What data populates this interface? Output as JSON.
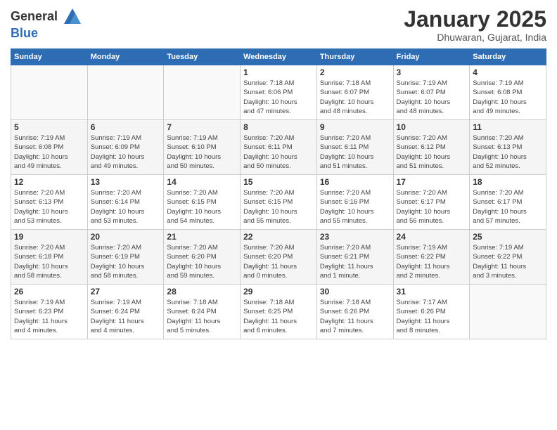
{
  "logo": {
    "general": "General",
    "blue": "Blue"
  },
  "header": {
    "title": "January 2025",
    "subtitle": "Dhuwaran, Gujarat, India"
  },
  "days_of_week": [
    "Sunday",
    "Monday",
    "Tuesday",
    "Wednesday",
    "Thursday",
    "Friday",
    "Saturday"
  ],
  "weeks": [
    [
      {
        "day": "",
        "info": ""
      },
      {
        "day": "",
        "info": ""
      },
      {
        "day": "",
        "info": ""
      },
      {
        "day": "1",
        "info": "Sunrise: 7:18 AM\nSunset: 6:06 PM\nDaylight: 10 hours\nand 47 minutes."
      },
      {
        "day": "2",
        "info": "Sunrise: 7:18 AM\nSunset: 6:07 PM\nDaylight: 10 hours\nand 48 minutes."
      },
      {
        "day": "3",
        "info": "Sunrise: 7:19 AM\nSunset: 6:07 PM\nDaylight: 10 hours\nand 48 minutes."
      },
      {
        "day": "4",
        "info": "Sunrise: 7:19 AM\nSunset: 6:08 PM\nDaylight: 10 hours\nand 49 minutes."
      }
    ],
    [
      {
        "day": "5",
        "info": "Sunrise: 7:19 AM\nSunset: 6:08 PM\nDaylight: 10 hours\nand 49 minutes."
      },
      {
        "day": "6",
        "info": "Sunrise: 7:19 AM\nSunset: 6:09 PM\nDaylight: 10 hours\nand 49 minutes."
      },
      {
        "day": "7",
        "info": "Sunrise: 7:19 AM\nSunset: 6:10 PM\nDaylight: 10 hours\nand 50 minutes."
      },
      {
        "day": "8",
        "info": "Sunrise: 7:20 AM\nSunset: 6:11 PM\nDaylight: 10 hours\nand 50 minutes."
      },
      {
        "day": "9",
        "info": "Sunrise: 7:20 AM\nSunset: 6:11 PM\nDaylight: 10 hours\nand 51 minutes."
      },
      {
        "day": "10",
        "info": "Sunrise: 7:20 AM\nSunset: 6:12 PM\nDaylight: 10 hours\nand 51 minutes."
      },
      {
        "day": "11",
        "info": "Sunrise: 7:20 AM\nSunset: 6:13 PM\nDaylight: 10 hours\nand 52 minutes."
      }
    ],
    [
      {
        "day": "12",
        "info": "Sunrise: 7:20 AM\nSunset: 6:13 PM\nDaylight: 10 hours\nand 53 minutes."
      },
      {
        "day": "13",
        "info": "Sunrise: 7:20 AM\nSunset: 6:14 PM\nDaylight: 10 hours\nand 53 minutes."
      },
      {
        "day": "14",
        "info": "Sunrise: 7:20 AM\nSunset: 6:15 PM\nDaylight: 10 hours\nand 54 minutes."
      },
      {
        "day": "15",
        "info": "Sunrise: 7:20 AM\nSunset: 6:15 PM\nDaylight: 10 hours\nand 55 minutes."
      },
      {
        "day": "16",
        "info": "Sunrise: 7:20 AM\nSunset: 6:16 PM\nDaylight: 10 hours\nand 55 minutes."
      },
      {
        "day": "17",
        "info": "Sunrise: 7:20 AM\nSunset: 6:17 PM\nDaylight: 10 hours\nand 56 minutes."
      },
      {
        "day": "18",
        "info": "Sunrise: 7:20 AM\nSunset: 6:17 PM\nDaylight: 10 hours\nand 57 minutes."
      }
    ],
    [
      {
        "day": "19",
        "info": "Sunrise: 7:20 AM\nSunset: 6:18 PM\nDaylight: 10 hours\nand 58 minutes."
      },
      {
        "day": "20",
        "info": "Sunrise: 7:20 AM\nSunset: 6:19 PM\nDaylight: 10 hours\nand 58 minutes."
      },
      {
        "day": "21",
        "info": "Sunrise: 7:20 AM\nSunset: 6:20 PM\nDaylight: 10 hours\nand 59 minutes."
      },
      {
        "day": "22",
        "info": "Sunrise: 7:20 AM\nSunset: 6:20 PM\nDaylight: 11 hours\nand 0 minutes."
      },
      {
        "day": "23",
        "info": "Sunrise: 7:20 AM\nSunset: 6:21 PM\nDaylight: 11 hours\nand 1 minute."
      },
      {
        "day": "24",
        "info": "Sunrise: 7:19 AM\nSunset: 6:22 PM\nDaylight: 11 hours\nand 2 minutes."
      },
      {
        "day": "25",
        "info": "Sunrise: 7:19 AM\nSunset: 6:22 PM\nDaylight: 11 hours\nand 3 minutes."
      }
    ],
    [
      {
        "day": "26",
        "info": "Sunrise: 7:19 AM\nSunset: 6:23 PM\nDaylight: 11 hours\nand 4 minutes."
      },
      {
        "day": "27",
        "info": "Sunrise: 7:19 AM\nSunset: 6:24 PM\nDaylight: 11 hours\nand 4 minutes."
      },
      {
        "day": "28",
        "info": "Sunrise: 7:18 AM\nSunset: 6:24 PM\nDaylight: 11 hours\nand 5 minutes."
      },
      {
        "day": "29",
        "info": "Sunrise: 7:18 AM\nSunset: 6:25 PM\nDaylight: 11 hours\nand 6 minutes."
      },
      {
        "day": "30",
        "info": "Sunrise: 7:18 AM\nSunset: 6:26 PM\nDaylight: 11 hours\nand 7 minutes."
      },
      {
        "day": "31",
        "info": "Sunrise: 7:17 AM\nSunset: 6:26 PM\nDaylight: 11 hours\nand 8 minutes."
      },
      {
        "day": "",
        "info": ""
      }
    ]
  ]
}
